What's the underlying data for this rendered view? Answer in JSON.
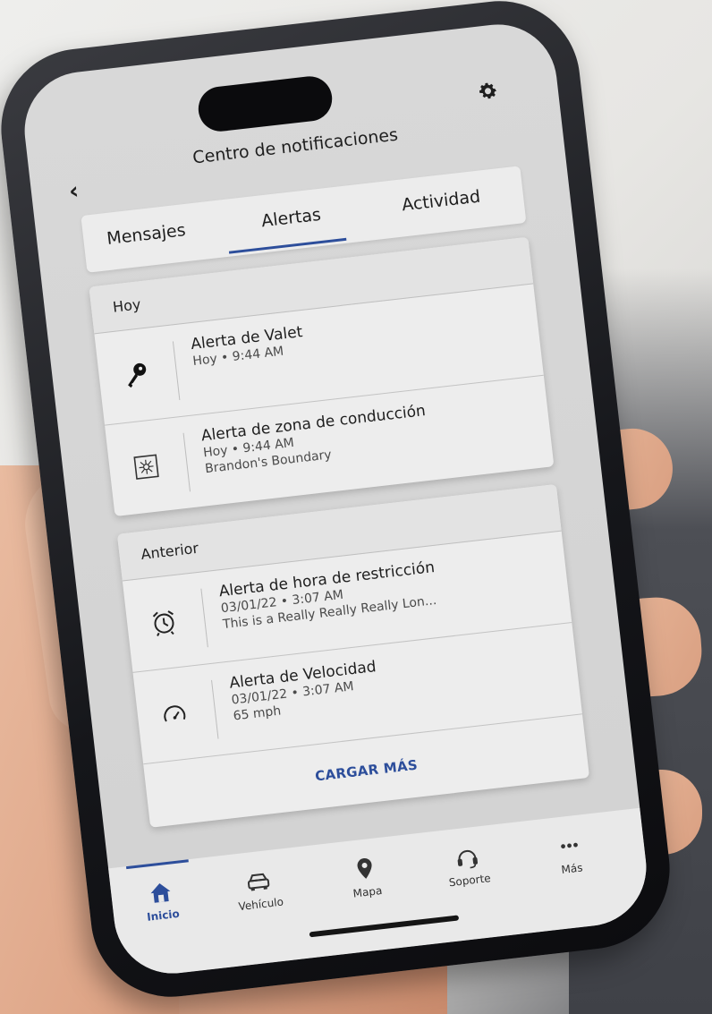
{
  "header": {
    "back_glyph": "‹",
    "title": "Centro de notificaciones"
  },
  "tabs": [
    {
      "label": "Mensajes"
    },
    {
      "label": "Alertas",
      "active": true
    },
    {
      "label": "Actividad"
    }
  ],
  "sections": [
    {
      "title": "Hoy",
      "items": [
        {
          "icon": "key-icon",
          "name": "Alerta de Valet",
          "lines": [
            "Hoy • 9:44 AM"
          ]
        },
        {
          "icon": "zone-icon",
          "name": "Alerta de zona de conducción",
          "lines": [
            "Hoy • 9:44 AM",
            "Brandon's Boundary"
          ]
        }
      ]
    },
    {
      "title": "Anterior",
      "items": [
        {
          "icon": "alarm-clock-icon",
          "name": "Alerta de hora de restricción",
          "lines": [
            "03/01/22 • 3:07 AM",
            "This is a Really Really Really Lon..."
          ]
        },
        {
          "icon": "speedometer-icon",
          "name": "Alerta de Velocidad",
          "lines": [
            "03/01/22 • 3:07 AM",
            "65 mph"
          ]
        }
      ],
      "load_more": "CARGAR MÁS"
    }
  ],
  "bottom_nav": [
    {
      "label": "Inicio",
      "icon": "home-icon",
      "active": true
    },
    {
      "label": "Vehículo",
      "icon": "car-icon"
    },
    {
      "label": "Mapa",
      "icon": "map-pin-icon"
    },
    {
      "label": "Soporte",
      "icon": "headset-icon"
    },
    {
      "label": "Más",
      "icon": "more-dots-icon"
    }
  ],
  "colors": {
    "accent": "#2d4e9b",
    "screen_bg": "#d6d6d6",
    "card_bg": "#ededed"
  }
}
